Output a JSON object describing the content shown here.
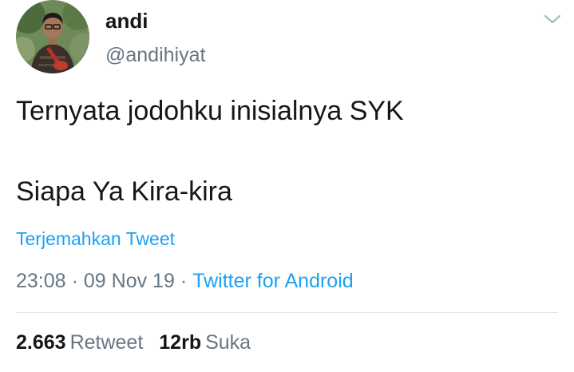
{
  "user": {
    "display_name": "andi",
    "handle": "@andihiyat"
  },
  "tweet": {
    "lines": [
      "Ternyata jodohku inisialnya SYK",
      "Siapa Ya Kira-kira"
    ],
    "translate_label": "Terjemahkan Tweet"
  },
  "meta": {
    "time": "23:08",
    "date": "09 Nov 19",
    "separator": "·",
    "source": "Twitter for Android"
  },
  "stats": {
    "retweets_count": "2.663",
    "retweets_label": "Retweet",
    "likes_count": "12rb",
    "likes_label": "Suka"
  },
  "icons": {
    "menu": "chevron-down-icon"
  },
  "colors": {
    "link": "#1da1f2",
    "secondary_text": "#657786",
    "primary_text": "#14171a",
    "divider": "#e1e8ed"
  }
}
